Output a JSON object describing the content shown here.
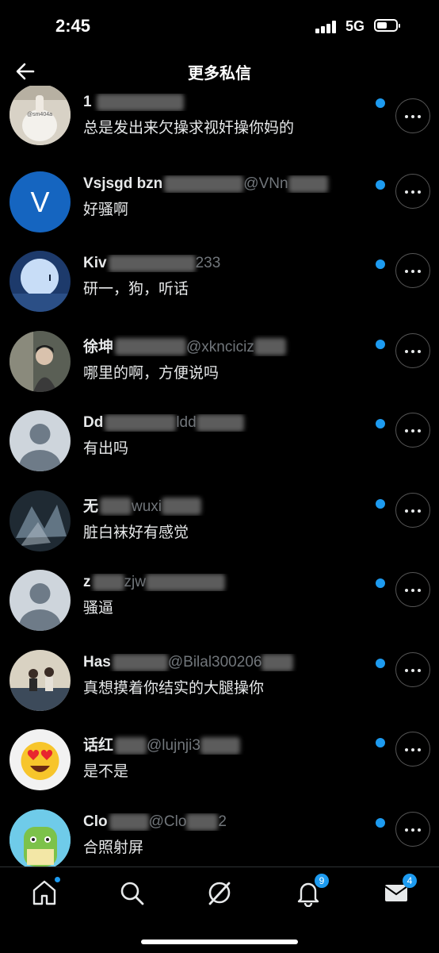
{
  "status": {
    "time": "2:45",
    "network": "5G"
  },
  "header": {
    "title": "更多私信"
  },
  "rows": [
    {
      "name": "1",
      "message": "总是发出来欠操求视奸操你妈的",
      "avatar_caption": "@sm404a"
    },
    {
      "name": "Vsjsgd bzn",
      "handle": "@VNn",
      "message": "好骚啊",
      "avatar_letter": "V"
    },
    {
      "name": "Kiv",
      "handle": "233",
      "message": "研一，狗，听话"
    },
    {
      "name": "徐坤",
      "handle": "@xknciciz",
      "message": "哪里的啊，方便说吗"
    },
    {
      "name": "Dd",
      "handle": "ldd",
      "message": "有出吗"
    },
    {
      "name": "无",
      "handle": "wuxi",
      "message": "脏白袜好有感觉"
    },
    {
      "name": "z",
      "handle": "zjw",
      "message": "骚逼"
    },
    {
      "name": "Has",
      "handle": "@Bilal300206",
      "message": "真想摸着你结实的大腿操你"
    },
    {
      "name": "话红",
      "handle": "@lujnji3",
      "message": "是不是"
    },
    {
      "name": "Clo",
      "handle": "@Clo",
      "handle2": "2",
      "message": "合照射屏"
    }
  ],
  "tabbar": {
    "notifications_badge": "9",
    "messages_badge": "4"
  },
  "colors": {
    "accent": "#1d9bf0",
    "background": "#000000"
  }
}
